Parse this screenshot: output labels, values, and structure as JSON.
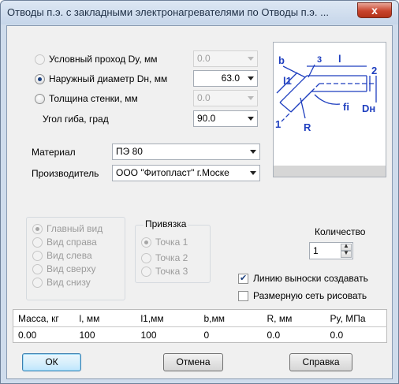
{
  "window": {
    "title": "Отводы п.э. с закладными электронагревателями по Отводы п.э. ...",
    "close_glyph": "x"
  },
  "dims": {
    "nominal": {
      "label": "Условный проход Dy, мм",
      "value": "0.0",
      "checked": false,
      "enabled": false
    },
    "outer": {
      "label": "Наружный диаметр Dн, мм",
      "value": "63.0",
      "checked": true,
      "enabled": true
    },
    "wall": {
      "label": "Толщина стенки, мм",
      "value": "0.0",
      "checked": false,
      "enabled": false
    },
    "angle": {
      "label": "Угол гиба, град",
      "value": "90.0"
    }
  },
  "material": {
    "label": "Материал",
    "value": "ПЭ 80"
  },
  "manufacturer": {
    "label": "Производитель",
    "value": "ООО \"Фитопласт\" г.Моске"
  },
  "diagram": {
    "labels": {
      "b": "b",
      "three": "3",
      "l": "l",
      "two": "2",
      "l1": "l1",
      "one": "1",
      "fi": "fi",
      "dn": "Dн",
      "r": "R"
    },
    "accent": "#1f3fbf"
  },
  "views": {
    "items": [
      "Главный вид",
      "Вид справа",
      "Вид слева",
      "Вид сверху",
      "Вид снизу"
    ],
    "selected": 0
  },
  "binding": {
    "title": "Привязка",
    "items": [
      "Точка 1",
      "Точка 2",
      "Точка 3"
    ],
    "selected": 0
  },
  "quantity": {
    "label": "Количество",
    "value": "1"
  },
  "options": {
    "leader": {
      "label": "Линию выноски создавать",
      "checked": true
    },
    "dimgrid": {
      "label": "Размерную сеть рисовать",
      "checked": false
    }
  },
  "results": {
    "headers": [
      "Масса, кг",
      "l, мм",
      "l1,мм",
      "b,мм",
      "R, мм",
      "Py, МПа"
    ],
    "row": [
      "0.00",
      "100",
      "100",
      "0",
      "0.0",
      "0.0"
    ]
  },
  "buttons": {
    "ok": "ОК",
    "cancel": "Отмена",
    "help": "Справка"
  }
}
